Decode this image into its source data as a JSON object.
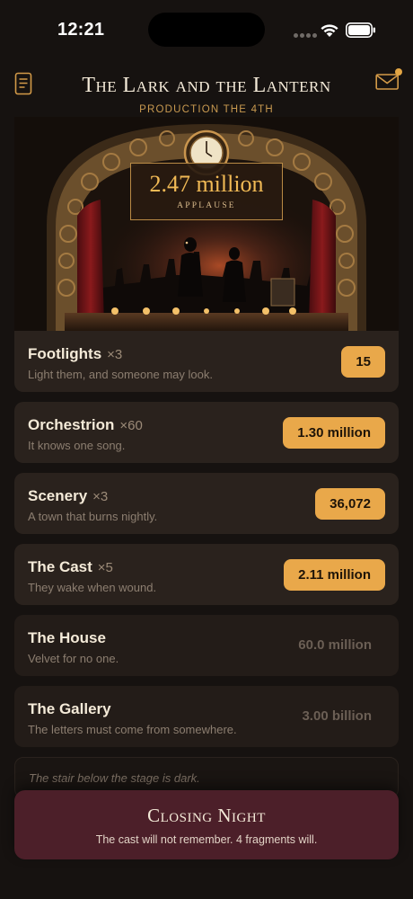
{
  "status_bar": {
    "time": "12:21"
  },
  "header": {
    "title": "The Lark and the Lantern",
    "subtitle": "PRODUCTION THE 4TH",
    "left_icon": "document-icon",
    "right_icon": "mail-icon",
    "notification_color": "#e3a644"
  },
  "hero": {
    "applause_value": "2.47 million",
    "applause_label": "APPLAUSE"
  },
  "upgrades": [
    {
      "name": "Footlights",
      "count": "×3",
      "description": "Light them, and someone may look.",
      "price": "15"
    },
    {
      "name": "Orchestrion",
      "count": "×60",
      "description": "It knows one song.",
      "price": "1.30 million"
    },
    {
      "name": "Scenery",
      "count": "×3",
      "description": "A town that burns nightly.",
      "price": "36,072"
    },
    {
      "name": "The Cast",
      "count": "×5",
      "description": "They wake when wound.",
      "price": "2.11 million"
    },
    {
      "name": "The House",
      "description": "Velvet for no one.",
      "price": "60.0 million"
    },
    {
      "name": "The Gallery",
      "description": "The letters must come from somewhere.",
      "price": "3.00 billion"
    }
  ],
  "locked_note": "The stair below the stage is dark.",
  "closing": {
    "title": "Closing Night",
    "subtitle": "The cast will not remember. 4 fragments will."
  },
  "colors": {
    "background": "#161210",
    "card": "#2a221d",
    "accent": "#e9a84a",
    "closing": "#4c1f29"
  }
}
